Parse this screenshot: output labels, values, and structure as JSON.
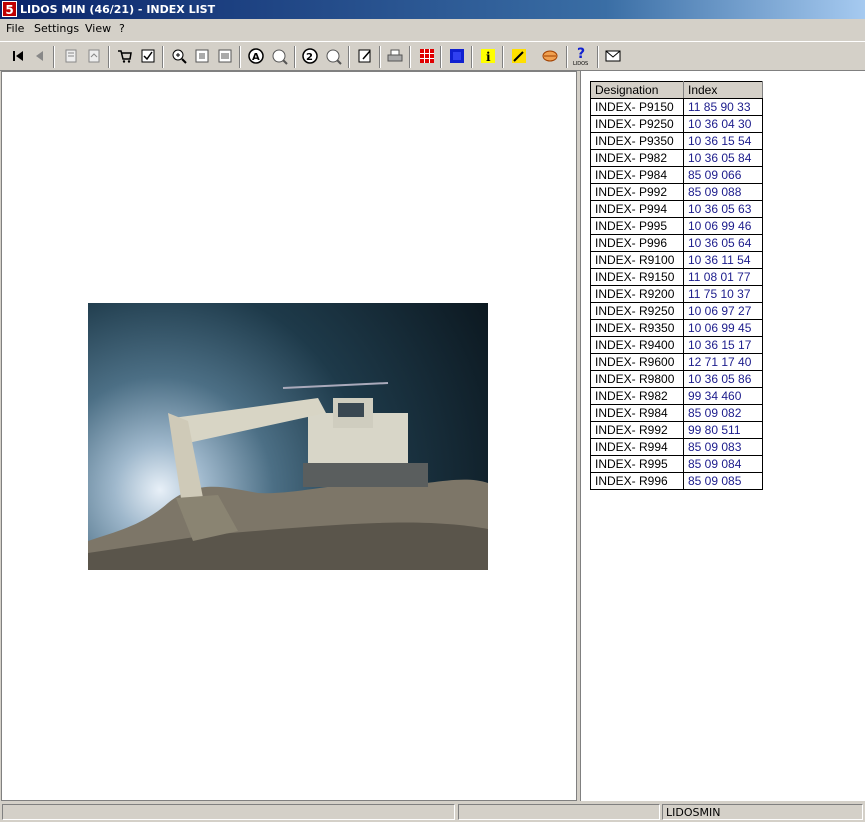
{
  "window": {
    "title": "LIDOS MIN (46/21) - INDEX LIST",
    "app_icon_text": "5"
  },
  "menu": {
    "items": [
      "File",
      "Settings",
      "View",
      "?"
    ]
  },
  "toolbar": {
    "icons": [
      "first-page-icon",
      "previous-page-icon",
      "sep",
      "open-document-icon",
      "close-document-icon",
      "sep",
      "cart-icon",
      "checklist-icon",
      "sep",
      "zoom-in-icon",
      "fit-page-icon",
      "fit-width-icon",
      "sep",
      "search-text-icon",
      "search-next-icon",
      "sep",
      "search-number-icon",
      "search-number-next-icon",
      "sep",
      "notepad-icon",
      "sep",
      "print-icon",
      "sep",
      "grid-red-icon",
      "sep",
      "grid-blue-icon",
      "sep",
      "info-icon",
      "sep",
      "tools-icon",
      "handshake-icon",
      "sep",
      "lidos-help-icon",
      "sep",
      "mail-icon"
    ]
  },
  "index_table": {
    "headers": [
      "Designation",
      "Index"
    ],
    "rows": [
      [
        "INDEX- P9150",
        "11 85 90 33"
      ],
      [
        "INDEX- P9250",
        "10 36 04 30"
      ],
      [
        "INDEX- P9350",
        "10 36 15 54"
      ],
      [
        "INDEX- P982",
        "10 36 05 84"
      ],
      [
        "INDEX- P984",
        "85 09 066"
      ],
      [
        "INDEX- P992",
        "85 09 088"
      ],
      [
        "INDEX- P994",
        "10 36 05 63"
      ],
      [
        "INDEX- P995",
        "10 06 99 46"
      ],
      [
        "INDEX- P996",
        "10 36 05 64"
      ],
      [
        "INDEX- R9100",
        "10 36 11 54"
      ],
      [
        "INDEX- R9150",
        "11 08 01 77"
      ],
      [
        "INDEX- R9200",
        "11 75 10 37"
      ],
      [
        "INDEX- R9250",
        "10 06 97 27"
      ],
      [
        "INDEX- R9350",
        "10 06 99 45"
      ],
      [
        "INDEX- R9400",
        "10 36 15 17"
      ],
      [
        "INDEX- R9600",
        "12 71 17 40"
      ],
      [
        "INDEX- R9800",
        "10 36 05 86"
      ],
      [
        "INDEX- R982",
        "99 34 460"
      ],
      [
        "INDEX- R984",
        "85 09 082"
      ],
      [
        "INDEX- R992",
        "99 80 511"
      ],
      [
        "INDEX- R994",
        "85 09 083"
      ],
      [
        "INDEX- R995",
        "85 09 084"
      ],
      [
        "INDEX- R996",
        "85 09 085"
      ]
    ]
  },
  "colors": {
    "link": "#1c1c8c",
    "title_start": "#0a246a",
    "title_end": "#a6caf0",
    "app_icon": "#c00000"
  },
  "statusbar": {
    "panels": [
      "",
      "",
      "LIDOSMIN"
    ]
  }
}
